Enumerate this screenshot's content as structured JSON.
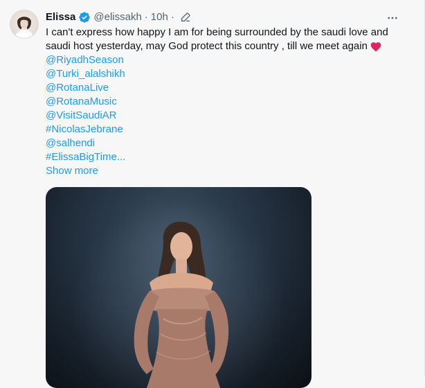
{
  "tweet": {
    "author": {
      "name": "Elissa",
      "handle": "@elissakh",
      "verified": true
    },
    "meta": {
      "separator": "·",
      "time": "10h",
      "edited": true
    },
    "text_lines": [
      "I can't express how happy I am for being surrounded by the saudi love and",
      "saudi host yesterday,  may God protect this country , till we meet again"
    ],
    "heart_icon": "heart-icon",
    "links": [
      "@RiyadhSeason",
      "@Turki_alalshikh",
      "@RotanaLive",
      "@RotanaMusic",
      "@VisitSaudiAR",
      "#NicolasJebrane",
      "@salhendi",
      "#ElissaBigTime..."
    ],
    "show_more_label": "Show more",
    "icons": {
      "verified": "verified-badge-icon",
      "edit": "edit-icon",
      "more": "more-options-icon"
    },
    "colors": {
      "link": "#1d9bf0",
      "text": "#0f1419",
      "secondary": "#536471",
      "heart": "#e0245e"
    }
  }
}
